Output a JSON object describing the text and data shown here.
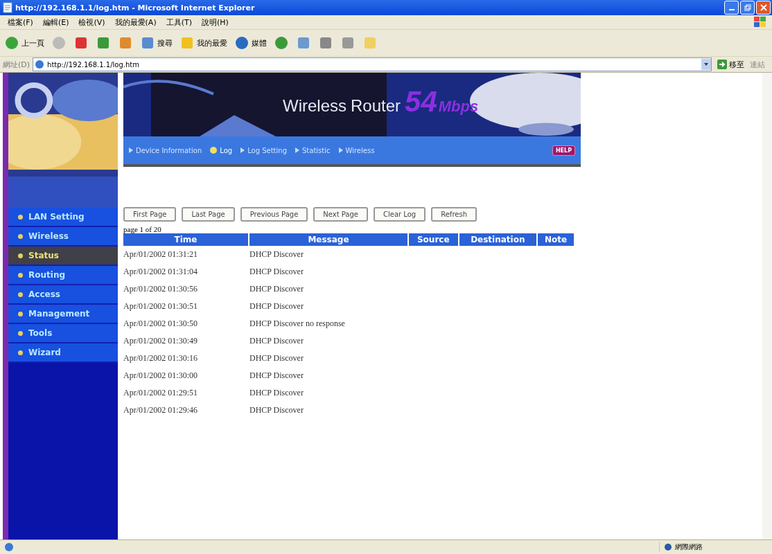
{
  "window": {
    "title": "http://192.168.1.1/log.htm - Microsoft Internet Explorer"
  },
  "menu_bar": [
    "檔案(F)",
    "編輯(E)",
    "檢視(V)",
    "我的最愛(A)",
    "工具(T)",
    "說明(H)"
  ],
  "toolbar": [
    {
      "kind": "back",
      "label": "上一頁"
    },
    {
      "kind": "forward"
    },
    {
      "kind": "stop"
    },
    {
      "kind": "refresh"
    },
    {
      "kind": "home"
    },
    {
      "kind": "search",
      "label": "搜尋"
    },
    {
      "kind": "favorites",
      "label": "我的最愛"
    },
    {
      "kind": "media",
      "label": "媒體"
    },
    {
      "kind": "history"
    },
    {
      "kind": "mail"
    },
    {
      "kind": "print"
    },
    {
      "kind": "edit"
    },
    {
      "kind": "folder"
    }
  ],
  "address_bar": {
    "label": "網址(D)",
    "value": "http://192.168.1.1/log.htm",
    "go": "移至",
    "links": "連結"
  },
  "banner": {
    "title_1": "Wireless",
    "title_2": "Router",
    "speed": "54",
    "unit": "Mbps"
  },
  "nav": [
    {
      "label": "Device Information",
      "selected": false
    },
    {
      "label": "Log",
      "selected": true
    },
    {
      "label": "Log Setting",
      "selected": false
    },
    {
      "label": "Statistic",
      "selected": false
    },
    {
      "label": "Wireless",
      "selected": false
    }
  ],
  "help": "HELP",
  "sidebar": {
    "items": [
      {
        "label": "LAN Setting",
        "selected": false
      },
      {
        "label": "Wireless",
        "selected": false
      },
      {
        "label": "Status",
        "selected": true
      },
      {
        "label": "Routing",
        "selected": false
      },
      {
        "label": "Access",
        "selected": false
      },
      {
        "label": "Management",
        "selected": false
      },
      {
        "label": "Tools",
        "selected": false
      },
      {
        "label": "Wizard",
        "selected": false
      }
    ]
  },
  "buttons": [
    "First Page",
    "Last Page",
    "Previous Page",
    "Next Page",
    "Clear Log",
    "Refresh"
  ],
  "page_info": "page 1 of 20",
  "table": {
    "columns": [
      "Time",
      "Message",
      "Source",
      "Destination",
      "Note"
    ],
    "rows": [
      [
        "Apr/01/2002 01:31:21",
        "DHCP Discover"
      ],
      [
        "Apr/01/2002 01:31:04",
        "DHCP Discover"
      ],
      [
        "Apr/01/2002 01:30:56",
        "DHCP Discover"
      ],
      [
        "Apr/01/2002 01:30:51",
        "DHCP Discover"
      ],
      [
        "Apr/01/2002 01:30:50",
        "DHCP Discover no response"
      ],
      [
        "Apr/01/2002 01:30:49",
        "DHCP Discover"
      ],
      [
        "Apr/01/2002 01:30:16",
        "DHCP Discover"
      ],
      [
        "Apr/01/2002 01:30:00",
        "DHCP Discover"
      ],
      [
        "Apr/01/2002 01:29:51",
        "DHCP Discover"
      ],
      [
        "Apr/01/2002 01:29:46",
        "DHCP Discover"
      ]
    ]
  },
  "status_bar": {
    "zone": "網際網路"
  }
}
